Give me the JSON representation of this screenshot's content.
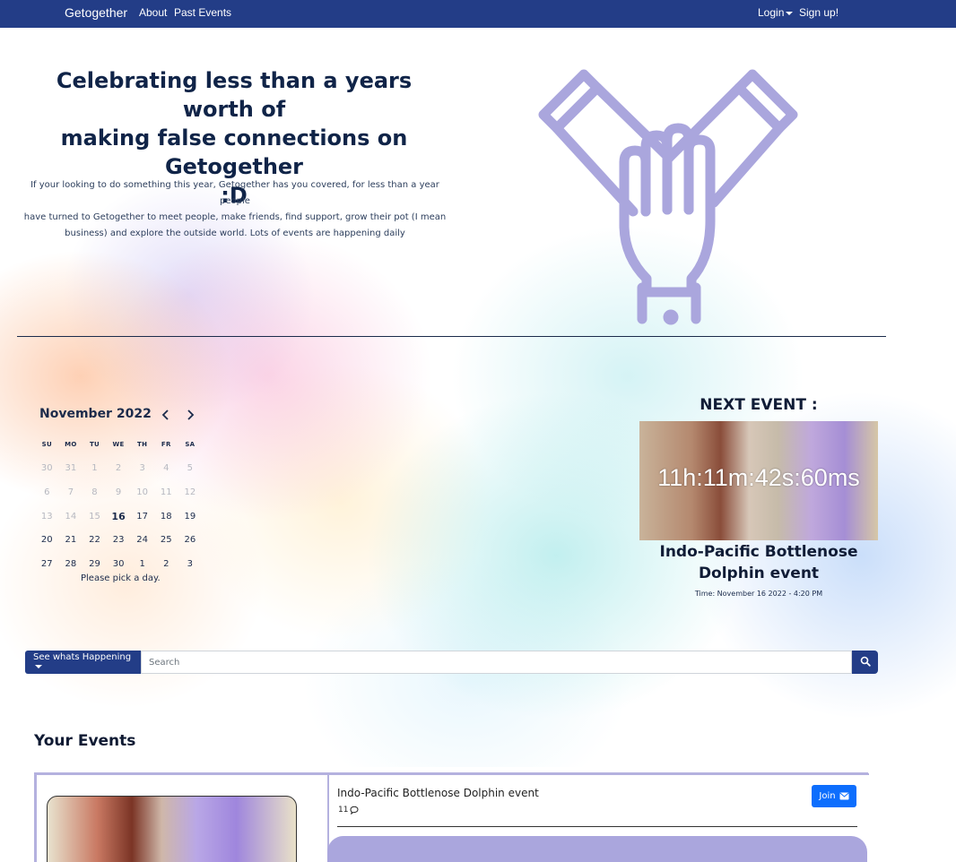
{
  "navbar": {
    "brand": "Getogether",
    "links": [
      "About",
      "Past Events"
    ],
    "login": "Login",
    "signup": "Sign up!"
  },
  "hero": {
    "title_line1": "Celebrating less than a years worth of",
    "title_line2": "making false connections on Getogether",
    "title_line3": ":D",
    "text_line1": "If your looking to do something this year, Getogether has you covered, for less than a year people",
    "text_line2": "have turned to Getogether to meet people, make friends, find support, grow their pot (I mean",
    "text_line3": "business) and explore the outside world. Lots of events are happening daily",
    "icon": "hands-together-icon"
  },
  "calendar": {
    "month": "November 2022",
    "weekdays": [
      "SU",
      "MO",
      "TU",
      "WE",
      "TH",
      "FR",
      "SA"
    ],
    "weeks": [
      [
        "30",
        "31",
        "1",
        "2",
        "3",
        "4",
        "5"
      ],
      [
        "6",
        "7",
        "8",
        "9",
        "10",
        "11",
        "12"
      ],
      [
        "13",
        "14",
        "15",
        "16",
        "17",
        "18",
        "19"
      ],
      [
        "20",
        "21",
        "22",
        "23",
        "24",
        "25",
        "26"
      ],
      [
        "27",
        "28",
        "29",
        "30",
        "1",
        "2",
        "3"
      ]
    ],
    "hint": "Please pick a day."
  },
  "next_event": {
    "heading": "NEXT EVENT :",
    "countdown": "11h:11m:42s:60ms",
    "title_line1": "Indo-Pacific Bottlenose",
    "title_line2": "Dolphin event",
    "time": "Time: November 16 2022 - 4:20 PM"
  },
  "search": {
    "dropdown_label": "See whats Happening",
    "placeholder": "Search"
  },
  "your_events": {
    "heading": "Your Events",
    "items": [
      {
        "name": "Indo-Pacific Bottlenose Dolphin event",
        "comment_count": "11",
        "join_label": "Join"
      }
    ]
  },
  "colors": {
    "navbar": "#233d87",
    "accent_lavender": "#aaa6dd",
    "join_button": "#0d6efd"
  }
}
